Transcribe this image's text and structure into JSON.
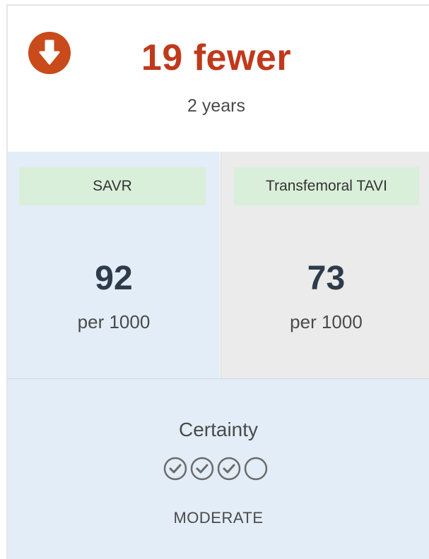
{
  "effect": {
    "direction": "down",
    "icon": "arrow-down-circle-icon",
    "value_text": "19 fewer",
    "duration_text": "2 years",
    "accent_color": "#c0391b"
  },
  "comparison": {
    "left": {
      "label": "SAVR",
      "value": "92",
      "unit": "per 1000"
    },
    "right": {
      "label": "Transfemoral TAVI",
      "value": "73",
      "unit": "per 1000"
    }
  },
  "certainty": {
    "label": "Certainty",
    "level": "MODERATE",
    "filled": 3,
    "total": 4,
    "icons": [
      "check-circle-icon",
      "check-circle-icon",
      "check-circle-icon",
      "empty-circle-icon"
    ]
  }
}
